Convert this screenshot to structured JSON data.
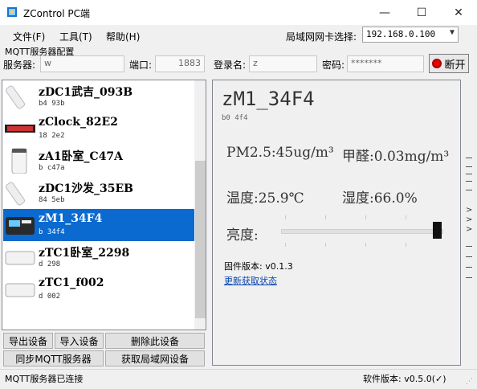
{
  "window": {
    "title": "ZControl PC端",
    "minimize": "—",
    "maximize": "☐",
    "close": "✕"
  },
  "menu": {
    "file": "文件(F)",
    "tools": "工具(T)",
    "help": "帮助(H)"
  },
  "nic": {
    "label": "局域网网卡选择:",
    "value": "192.168.0.100"
  },
  "mqtt": {
    "group_label": "MQTT服务器配置",
    "server_label": "服务器:",
    "server_value": "w",
    "port_label": "端口:",
    "port_value": "1883",
    "login_label": "登录名:",
    "login_value": "z",
    "password_label": "密码:",
    "password_value": "*******",
    "disconnect_label": "断开"
  },
  "devices": [
    {
      "name": "zDC1武吉_093B",
      "id": "b4     93b"
    },
    {
      "name": "zClock_82E2",
      "id": "18      2e2"
    },
    {
      "name": "zA1卧室_C47A",
      "id": "b      c47a"
    },
    {
      "name": "zDC1沙发_35EB",
      "id": "84      5eb"
    },
    {
      "name": "zM1_34F4",
      "id": "b       34f4"
    },
    {
      "name": "zTC1卧室_2298",
      "id": "d       298"
    },
    {
      "name": "zTC1_f002",
      "id": "d       002"
    }
  ],
  "selected_index": 4,
  "buttons": {
    "export": "导出设备",
    "import": "导入设备",
    "delete": "删除此设备",
    "sync": "同步MQTT服务器",
    "fetch": "获取局域网设备"
  },
  "detail": {
    "name": "zM1_34F4",
    "id": "b0          4f4",
    "pm25": "PM2.5:45ug/m³",
    "formaldehyde": "甲醛:0.03mg/m³",
    "temperature": "温度:25.9℃",
    "humidity": "湿度:66.0%",
    "brightness_label": "亮度:",
    "brightness_level": 1.0,
    "firmware": "固件版本: v0.1.3",
    "refresh": "更新获取状态"
  },
  "status": {
    "text": "MQTT服务器已连接",
    "version": "软件版本: v0.5.0(✓)"
  },
  "colors": {
    "selection": "#0a6ad0",
    "link": "#0645ad",
    "disconnect": "#e00000"
  }
}
